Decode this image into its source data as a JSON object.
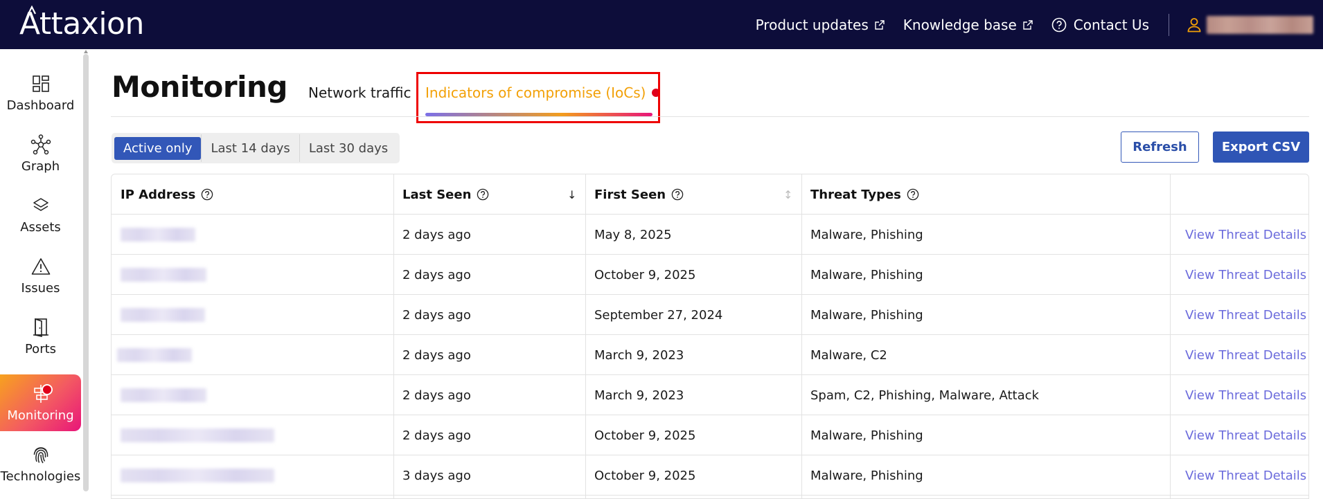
{
  "app": {
    "brand": "Attaxion",
    "colors": {
      "topbar": "#0d0d3a",
      "accent": "#3257b8",
      "tab_active": "#f2a007",
      "alert_dot": "#e0001b",
      "link": "#6b6bdc"
    }
  },
  "topnav": {
    "product_updates": "Product updates",
    "knowledge_base": "Knowledge base",
    "contact_us": "Contact Us",
    "icons": {
      "external": "external-link-icon",
      "help": "help-circle-icon",
      "user": "user-icon"
    }
  },
  "sidebar": {
    "items": [
      {
        "label": "Dashboard",
        "icon": "dashboard-icon"
      },
      {
        "label": "Graph",
        "icon": "graph-icon"
      },
      {
        "label": "Assets",
        "icon": "layers-icon"
      },
      {
        "label": "Issues",
        "icon": "warning-icon"
      },
      {
        "label": "Ports",
        "icon": "door-icon"
      },
      {
        "label": "Monitoring",
        "icon": "monitoring-icon",
        "active": true,
        "alert": true
      },
      {
        "label": "Technologies",
        "icon": "fingerprint-icon"
      }
    ]
  },
  "page": {
    "title": "Monitoring",
    "tabs": [
      {
        "label": "Network traffic"
      },
      {
        "label": "Indicators of compromise (IoCs)",
        "active": true,
        "alert": true
      }
    ],
    "filters": [
      {
        "label": "Active only",
        "active": true
      },
      {
        "label": "Last 14 days"
      },
      {
        "label": "Last 30 days"
      }
    ],
    "refresh_label": "Refresh",
    "export_label": "Export CSV"
  },
  "table": {
    "columns": {
      "ip": "IP Address",
      "last_seen": "Last Seen",
      "first_seen": "First Seen",
      "threat_types": "Threat Types"
    },
    "sort": {
      "last_seen": "↓",
      "first_seen": "↕"
    },
    "rows": [
      {
        "last_seen": "2 days ago",
        "first_seen": "May 8, 2025",
        "threats": "Malware, Phishing",
        "action": "View Threat Details"
      },
      {
        "last_seen": "2 days ago",
        "first_seen": "October 9, 2025",
        "threats": "Malware, Phishing",
        "action": "View Threat Details"
      },
      {
        "last_seen": "2 days ago",
        "first_seen": "September 27, 2024",
        "threats": "Malware, Phishing",
        "action": "View Threat Details"
      },
      {
        "last_seen": "2 days ago",
        "first_seen": "March 9, 2023",
        "threats": "Malware, C2",
        "action": "View Threat Details"
      },
      {
        "last_seen": "2 days ago",
        "first_seen": "March 9, 2023",
        "threats": "Spam, C2, Phishing, Malware, Attack",
        "action": "View Threat Details"
      },
      {
        "last_seen": "2 days ago",
        "first_seen": "October 9, 2025",
        "threats": "Malware, Phishing",
        "action": "View Threat Details"
      },
      {
        "last_seen": "3 days ago",
        "first_seen": "October 9, 2025",
        "threats": "Malware, Phishing",
        "action": "View Threat Details"
      }
    ]
  }
}
